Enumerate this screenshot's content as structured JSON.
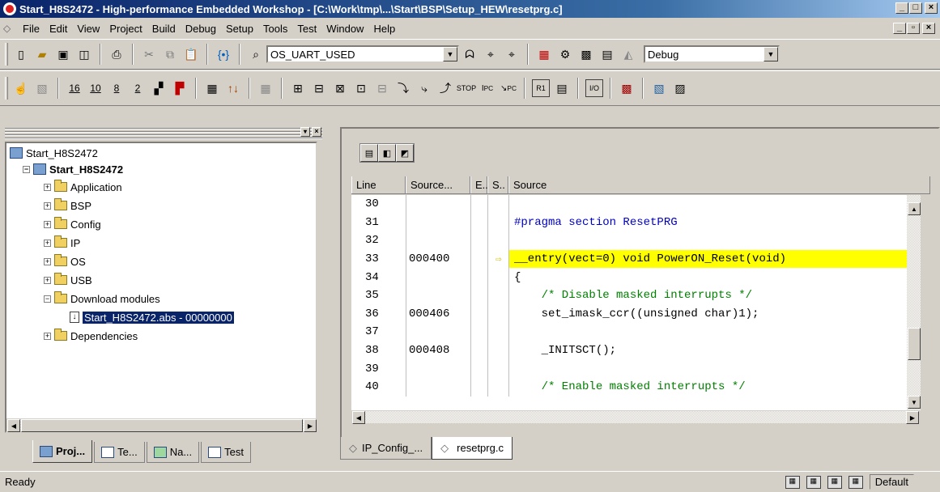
{
  "window": {
    "title": "Start_H8S2472 - High-performance Embedded Workshop - [C:\\Work\\tmp\\...\\Start\\BSP\\Setup_HEW\\resetprg.c]"
  },
  "menu": [
    "File",
    "Edit",
    "View",
    "Project",
    "Build",
    "Debug",
    "Setup",
    "Tools",
    "Test",
    "Window",
    "Help"
  ],
  "toolbar": {
    "search_combo": "OS_UART_USED",
    "config_combo": "Debug"
  },
  "tree": {
    "root": "Start_H8S2472",
    "project": "Start_H8S2472",
    "folders": [
      "Application",
      "BSP",
      "Config",
      "IP",
      "OS",
      "USB",
      "Download modules"
    ],
    "download_item": "Start_H8S2472.abs - 00000000",
    "dependencies": "Dependencies"
  },
  "left_tabs": [
    "Proj...",
    "Te...",
    "Na...",
    "Test"
  ],
  "editor": {
    "columns": [
      "Line",
      "Source...",
      "E..",
      "S..",
      "Source"
    ],
    "rows": [
      {
        "line": "30",
        "addr": "",
        "src": ""
      },
      {
        "line": "31",
        "addr": "",
        "src": "#pragma section ResetPRG"
      },
      {
        "line": "32",
        "addr": "",
        "src": ""
      },
      {
        "line": "33",
        "addr": "000400",
        "src": "__entry(vect=0) void PowerON_Reset(void)"
      },
      {
        "line": "34",
        "addr": "",
        "src": "{"
      },
      {
        "line": "35",
        "addr": "",
        "src": "    /* Disable masked interrupts */"
      },
      {
        "line": "36",
        "addr": "000406",
        "src": "    set_imask_ccr((unsigned char)1);"
      },
      {
        "line": "37",
        "addr": "",
        "src": ""
      },
      {
        "line": "38",
        "addr": "000408",
        "src": "    _INITSCT();"
      },
      {
        "line": "39",
        "addr": "",
        "src": ""
      },
      {
        "line": "40",
        "addr": "",
        "src": "    /* Enable masked interrupts */"
      }
    ],
    "tabs": [
      "IP_Config_...",
      "resetprg.c"
    ]
  },
  "status": {
    "text": "Ready",
    "session": "Default"
  }
}
